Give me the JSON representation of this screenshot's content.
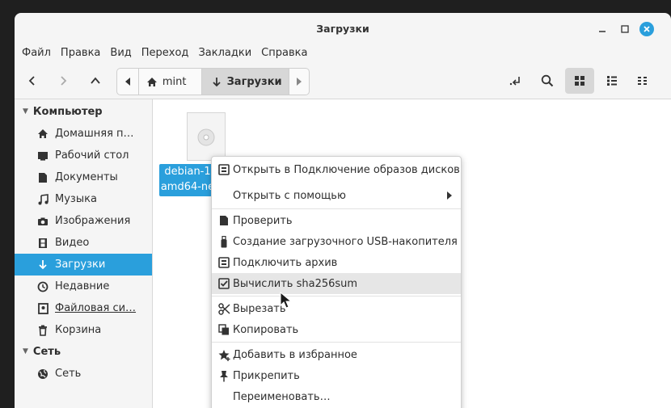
{
  "window": {
    "title": "Загрузки"
  },
  "menubar": [
    "Файл",
    "Правка",
    "Вид",
    "Переход",
    "Закладки",
    "Справка"
  ],
  "pathbar": {
    "home": "mint",
    "current": "Загрузки"
  },
  "sidebar": {
    "computer": "Компьютер",
    "items": [
      {
        "label": "Домашняя п…",
        "icon": "home-icon"
      },
      {
        "label": "Рабочий стол",
        "icon": "desktop-icon"
      },
      {
        "label": "Документы",
        "icon": "document-icon"
      },
      {
        "label": "Музыка",
        "icon": "music-icon"
      },
      {
        "label": "Изображения",
        "icon": "camera-icon"
      },
      {
        "label": "Видео",
        "icon": "film-icon"
      },
      {
        "label": "Загрузки",
        "icon": "download-icon"
      },
      {
        "label": "Недавние",
        "icon": "clock-icon"
      },
      {
        "label": "Файловая си…",
        "icon": "drive-icon"
      },
      {
        "label": "Корзина",
        "icon": "trash-icon"
      }
    ],
    "network": "Сеть",
    "network_items": [
      {
        "label": "Сеть",
        "icon": "globe-icon"
      }
    ]
  },
  "file": {
    "name_line1": "debian-1",
    "name_line2": "amd64-ne"
  },
  "context_menu": {
    "open_disk_image": "Открыть в Подключение образов дисков",
    "open_with": "Открыть с помощью",
    "verify": "Проверить",
    "usb": "Создание загрузочного USB-накопителя",
    "mount_archive": "Подключить архив",
    "sha256": "Вычислить sha256sum",
    "cut": "Вырезать",
    "copy": "Копировать",
    "favorite": "Добавить в избранное",
    "pin": "Прикрепить",
    "rename": "Переименовать…"
  },
  "colors": {
    "accent": "#2a9fdc",
    "highlight": "#e6e6e6"
  }
}
